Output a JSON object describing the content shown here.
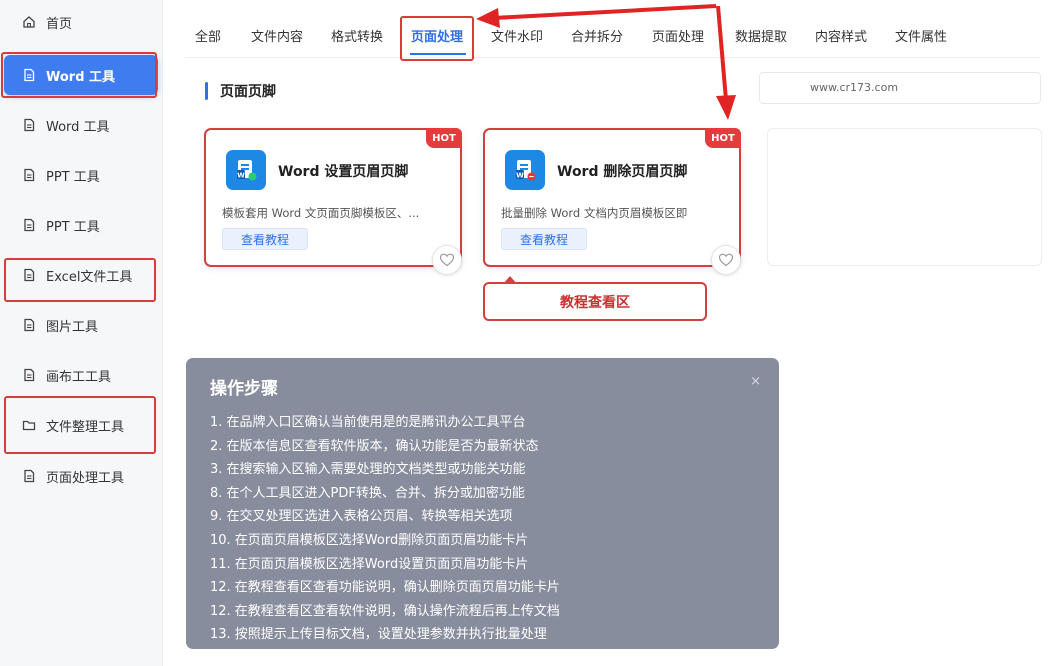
{
  "sidebar": {
    "items": [
      {
        "label": "首页",
        "icon": "home-icon"
      },
      {
        "label": "Word 工具",
        "icon": "document-icon",
        "active": true
      },
      {
        "label": "Word 工具",
        "icon": "document-icon"
      },
      {
        "label": "PPT 工具",
        "icon": "document-icon"
      },
      {
        "label": "PPT 工具",
        "icon": "document-icon"
      },
      {
        "label": "Excel文件工具",
        "icon": "document-icon"
      },
      {
        "label": "图片工具",
        "icon": "document-icon"
      },
      {
        "label": "画布工工具",
        "icon": "document-icon"
      },
      {
        "label": "文件整理工具",
        "icon": "folder-icon"
      },
      {
        "label": "页面处理工具",
        "icon": "document-icon"
      }
    ]
  },
  "tabs": [
    "全部",
    "文件内容",
    "格式转换",
    "页面处理",
    "文件水印",
    "合并拆分",
    "页面处理",
    "数据提取",
    "内容样式",
    "文件属性"
  ],
  "active_tab_index": 3,
  "section": {
    "title": "页面页脚"
  },
  "search": {
    "text": "www.cr173.com"
  },
  "cards": [
    {
      "title": "Word 设置页眉页脚",
      "desc": "模板套用 Word 文页面页脚模板区、...",
      "button": "查看教程",
      "badge": "HOT",
      "icon": "word-header-icon"
    },
    {
      "title": "Word 删除页眉页脚",
      "desc": "批量删除 Word 文档内页眉模板区即",
      "button": "查看教程",
      "badge": "HOT",
      "icon": "word-delete-icon"
    }
  ],
  "tutorial_tag": "教程查看区",
  "steps": {
    "title": "操作步骤",
    "close": "×",
    "items": [
      "1. 在品牌入口区确认当前使用是的是腾讯办公工具平台",
      "2. 在版本信息区查看软件版本，确认功能是否为最新状态",
      "3. 在搜索输入区输入需要处理的文档类型或功能关功能",
      "8. 在个人工具区进入PDF转换、合并、拆分或加密功能",
      "9. 在交叉处理区选进入表格公页眉、转换等相关选项",
      "10. 在页面页眉模板区选择Word删除页面页眉功能卡片",
      "11. 在页面页眉模板区选择Word设置页面页眉功能卡片",
      "12. 在教程查看区查看功能说明，确认删除页面页眉功能卡片",
      "12. 在教程查看区查看软件说明，确认操作流程后再上传文档",
      "13. 按照提示上传目标文档，设置处理参数并执行批量处理"
    ]
  },
  "colors": {
    "accent": "#2f6fe8",
    "highlight": "#d93a3a",
    "active_bg": "#3f7cf0",
    "panel": "#878d9c"
  }
}
